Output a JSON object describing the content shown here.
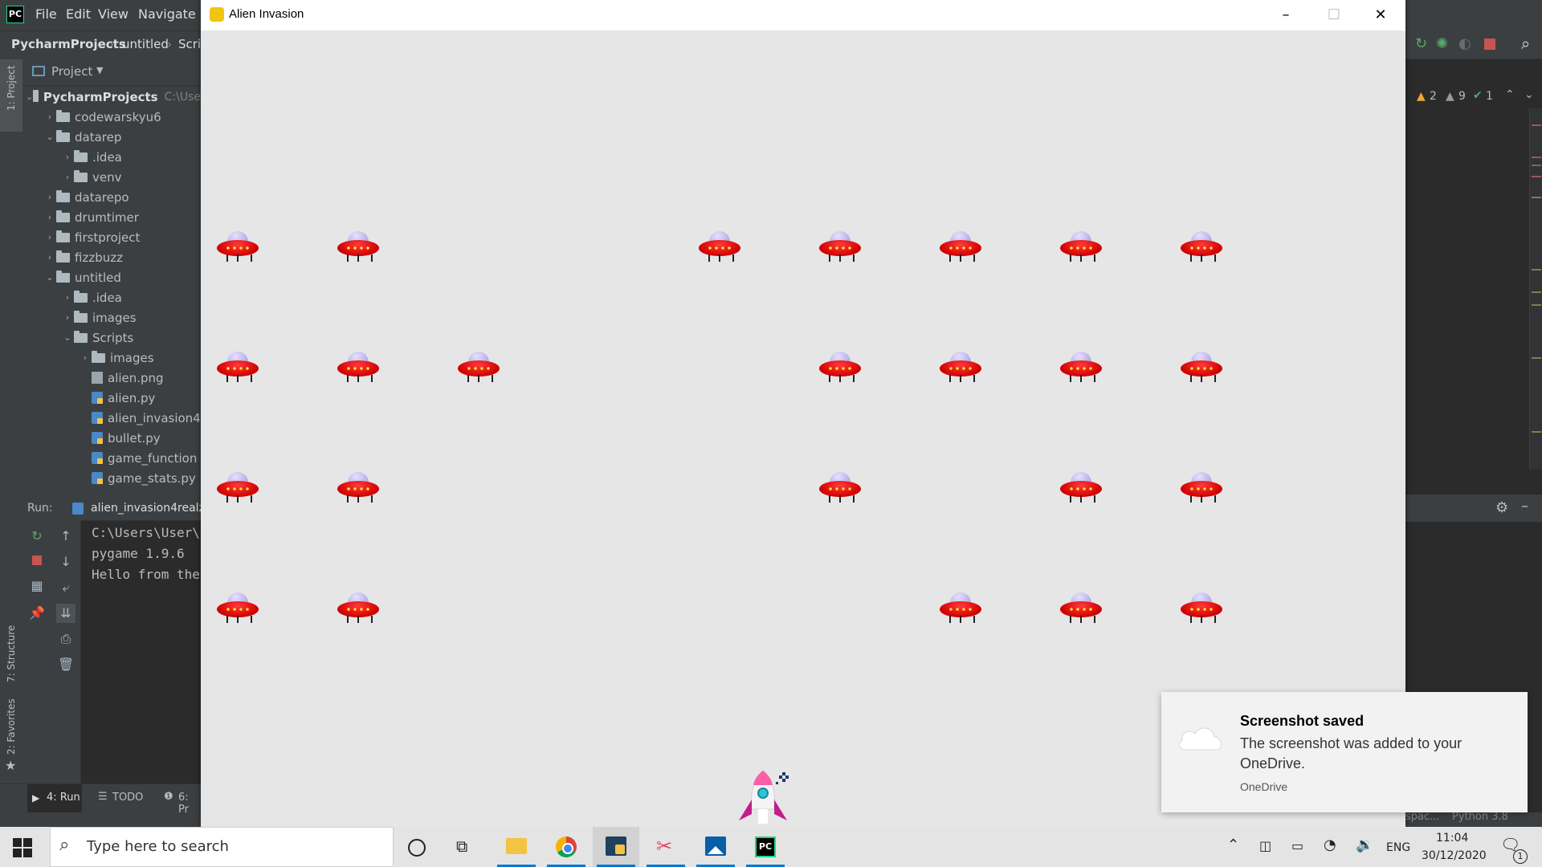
{
  "ide": {
    "menu": [
      "File",
      "Edit",
      "View",
      "Navigate"
    ],
    "breadcrumbs": [
      "PycharmProjects",
      "untitled",
      "Scri"
    ],
    "project_label": "Project",
    "side_tabs": [
      "1: Project",
      "7: Structure",
      "2: Favorites"
    ],
    "tree": [
      {
        "label": "PycharmProjects",
        "extra": "C:\\Use",
        "depth": 0,
        "type": "folder",
        "open": true
      },
      {
        "label": "codewarskyu6",
        "depth": 1,
        "type": "folder",
        "open": false
      },
      {
        "label": "datarep",
        "depth": 1,
        "type": "folder",
        "open": true
      },
      {
        "label": ".idea",
        "depth": 2,
        "type": "folder",
        "open": false
      },
      {
        "label": "venv",
        "depth": 2,
        "type": "folder",
        "open": false
      },
      {
        "label": "datarepo",
        "depth": 1,
        "type": "folder",
        "open": false
      },
      {
        "label": "drumtimer",
        "depth": 1,
        "type": "folder",
        "open": false
      },
      {
        "label": "firstproject",
        "depth": 1,
        "type": "folder",
        "open": false
      },
      {
        "label": "fizzbuzz",
        "depth": 1,
        "type": "folder",
        "open": false
      },
      {
        "label": "untitled",
        "depth": 1,
        "type": "folder",
        "open": true
      },
      {
        "label": ".idea",
        "depth": 2,
        "type": "folder",
        "open": false
      },
      {
        "label": "images",
        "depth": 2,
        "type": "folder",
        "open": false
      },
      {
        "label": "Scripts",
        "depth": 2,
        "type": "folder",
        "open": true
      },
      {
        "label": "images",
        "depth": 3,
        "type": "folder",
        "open": false
      },
      {
        "label": "alien.png",
        "depth": 3,
        "type": "png"
      },
      {
        "label": "alien.py",
        "depth": 3,
        "type": "py"
      },
      {
        "label": "alien_invasion4",
        "depth": 3,
        "type": "py"
      },
      {
        "label": "bullet.py",
        "depth": 3,
        "type": "py"
      },
      {
        "label": "game_function",
        "depth": 3,
        "type": "py"
      },
      {
        "label": "game_stats.py",
        "depth": 3,
        "type": "py"
      }
    ],
    "run": {
      "label": "Run:",
      "config": "alien_invasion4realz",
      "console": [
        "C:\\Users\\User\\",
        "pygame 1.9.6",
        "Hello from the"
      ]
    },
    "bottom_tabs": [
      "4: Run",
      "TODO",
      "6: Pr"
    ],
    "inspections": {
      "warnings": "2",
      "weak_warnings": "9",
      "ok": "1"
    },
    "status_right": [
      "spac...",
      "Python 3.8"
    ]
  },
  "game": {
    "title": "Alien Invasion",
    "background": "#e6e6e6",
    "alien_grid": {
      "columns": 9,
      "rows": [
        [
          1,
          1,
          0,
          0,
          1,
          1,
          1,
          1,
          1
        ],
        [
          1,
          1,
          1,
          0,
          0,
          1,
          1,
          1,
          1
        ],
        [
          1,
          1,
          0,
          0,
          0,
          1,
          0,
          1,
          1
        ],
        [
          1,
          1,
          0,
          0,
          0,
          0,
          1,
          1,
          1
        ]
      ]
    }
  },
  "notification": {
    "title": "Screenshot saved",
    "body": "The screenshot was added to your OneDrive.",
    "source": "OneDrive"
  },
  "taskbar": {
    "search_placeholder": "Type here to search",
    "language": "ENG",
    "time": "11:04",
    "date": "30/12/2020",
    "notification_count": "1"
  }
}
